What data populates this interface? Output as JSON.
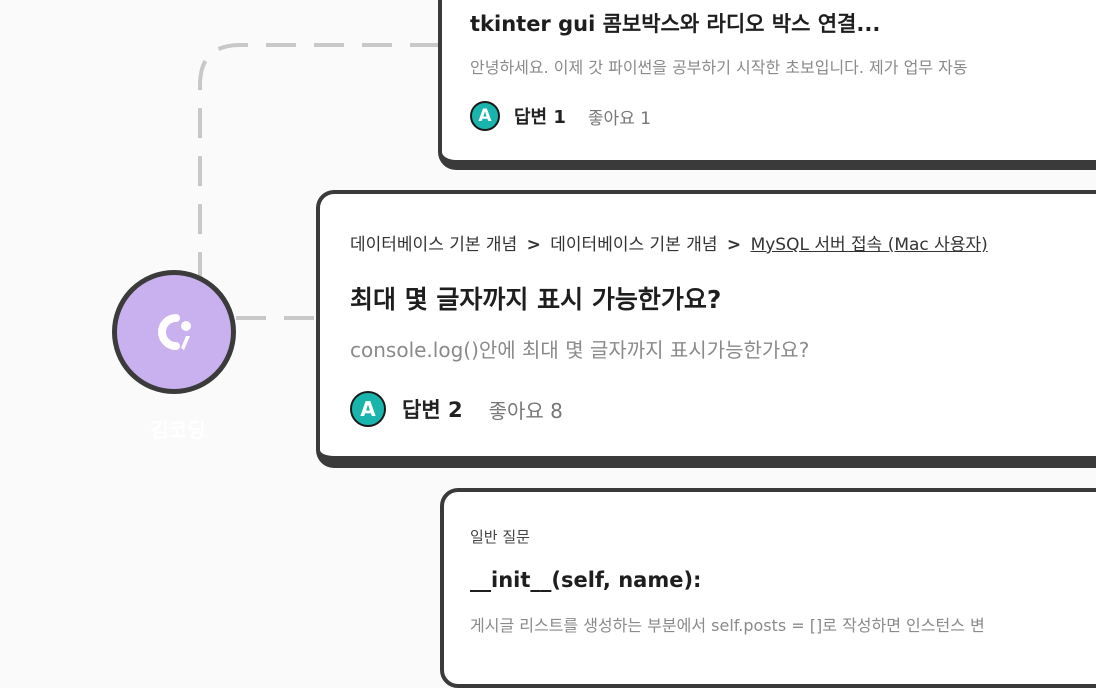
{
  "user": {
    "name": "김코딩",
    "avatar_icon": "codeit-logo-icon",
    "avatar_color": "#c9b0ee"
  },
  "accent_color": "#19b5ad",
  "questions": [
    {
      "title": "tkinter gui 콤보박스와 라디오 박스 연결...",
      "excerpt": "안녕하세요. 이제 갓 파이썬을 공부하기 시작한 초보입니다. 제가 업무 자동",
      "answer_badge": "A",
      "answers_label": "답변 1",
      "likes_label": "좋아요 1"
    },
    {
      "breadcrumb": [
        "데이터베이스 기본 개념",
        "데이터베이스 기본 개념",
        "MySQL 서버 접속 (Mac 사용자)"
      ],
      "title": "최대 몇 글자까지 표시 가능한가요?",
      "excerpt": "console.log()안에 최대 몇 글자까지 표시가능한가요?",
      "answer_badge": "A",
      "answers_label": "답변 2",
      "likes_label": "좋아요 8"
    },
    {
      "category": "일반 질문",
      "title": "__init__(self, name):",
      "excerpt": "게시글 리스트를 생성하는 부분에서 self.posts = []로 작성하면 인스턴스 변"
    }
  ]
}
